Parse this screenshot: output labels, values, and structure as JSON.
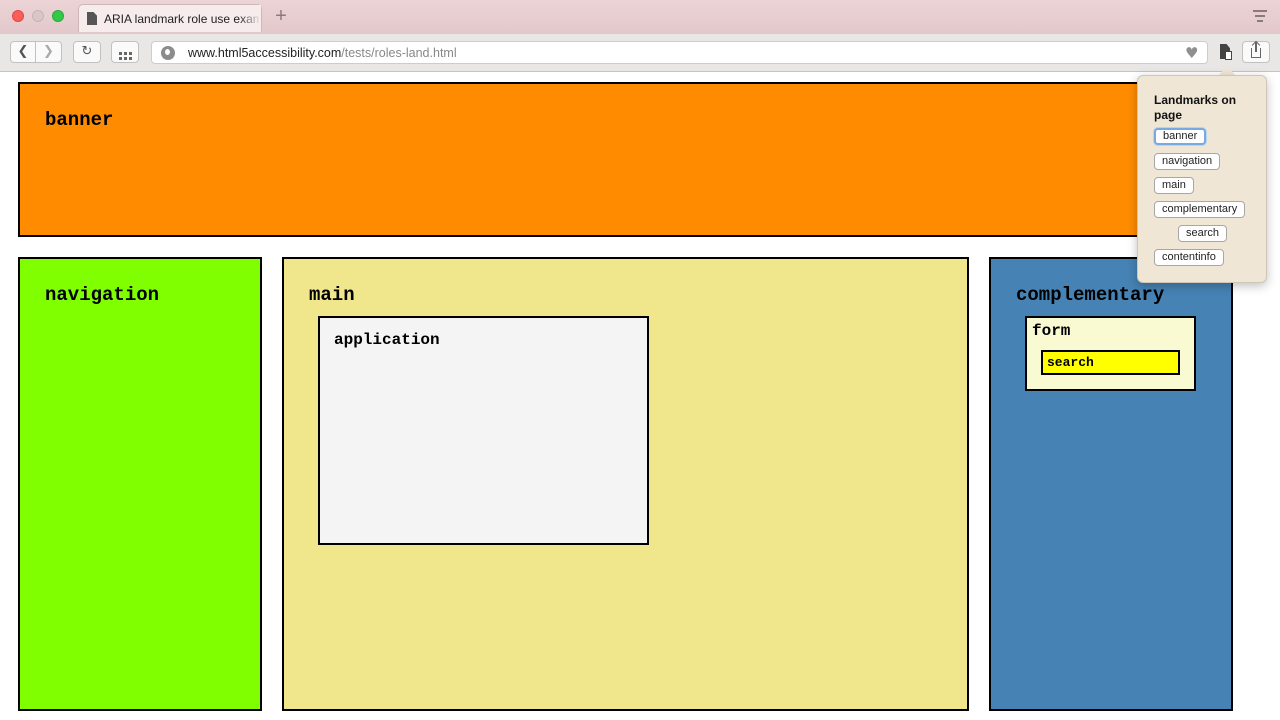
{
  "browser": {
    "tab_title": "ARIA landmark role use example",
    "url_domain": "www.html5accessibility.com",
    "url_path": "/tests/roles-land.html",
    "icons": {
      "back": "chevron-left-icon",
      "forward": "chevron-right-icon",
      "reload": "reload-icon",
      "top_sites": "grid-icon",
      "site": "globe-icon",
      "favorite": "heart-icon",
      "extension": "landmarks-extension-icon",
      "share": "share-icon",
      "new_tab": "plus-icon",
      "tab_overview": "tab-list-icon"
    }
  },
  "page": {
    "banner": {
      "label": "banner",
      "color": "#ff8c00"
    },
    "navigation": {
      "label": "navigation",
      "color": "#7fff00"
    },
    "main": {
      "label": "main",
      "color": "#f0e68c"
    },
    "application": {
      "label": "application",
      "color": "#f4f4f4"
    },
    "complementary": {
      "label": "complementary",
      "color": "#4682b4"
    },
    "form": {
      "label": "form",
      "color": "#fafad2"
    },
    "search": {
      "label": "search",
      "color": "#ffff00"
    }
  },
  "popover": {
    "title": "Landmarks on page",
    "items": [
      "banner",
      "navigation",
      "main",
      "complementary",
      "search",
      "contentinfo"
    ],
    "focused_item": "banner"
  }
}
